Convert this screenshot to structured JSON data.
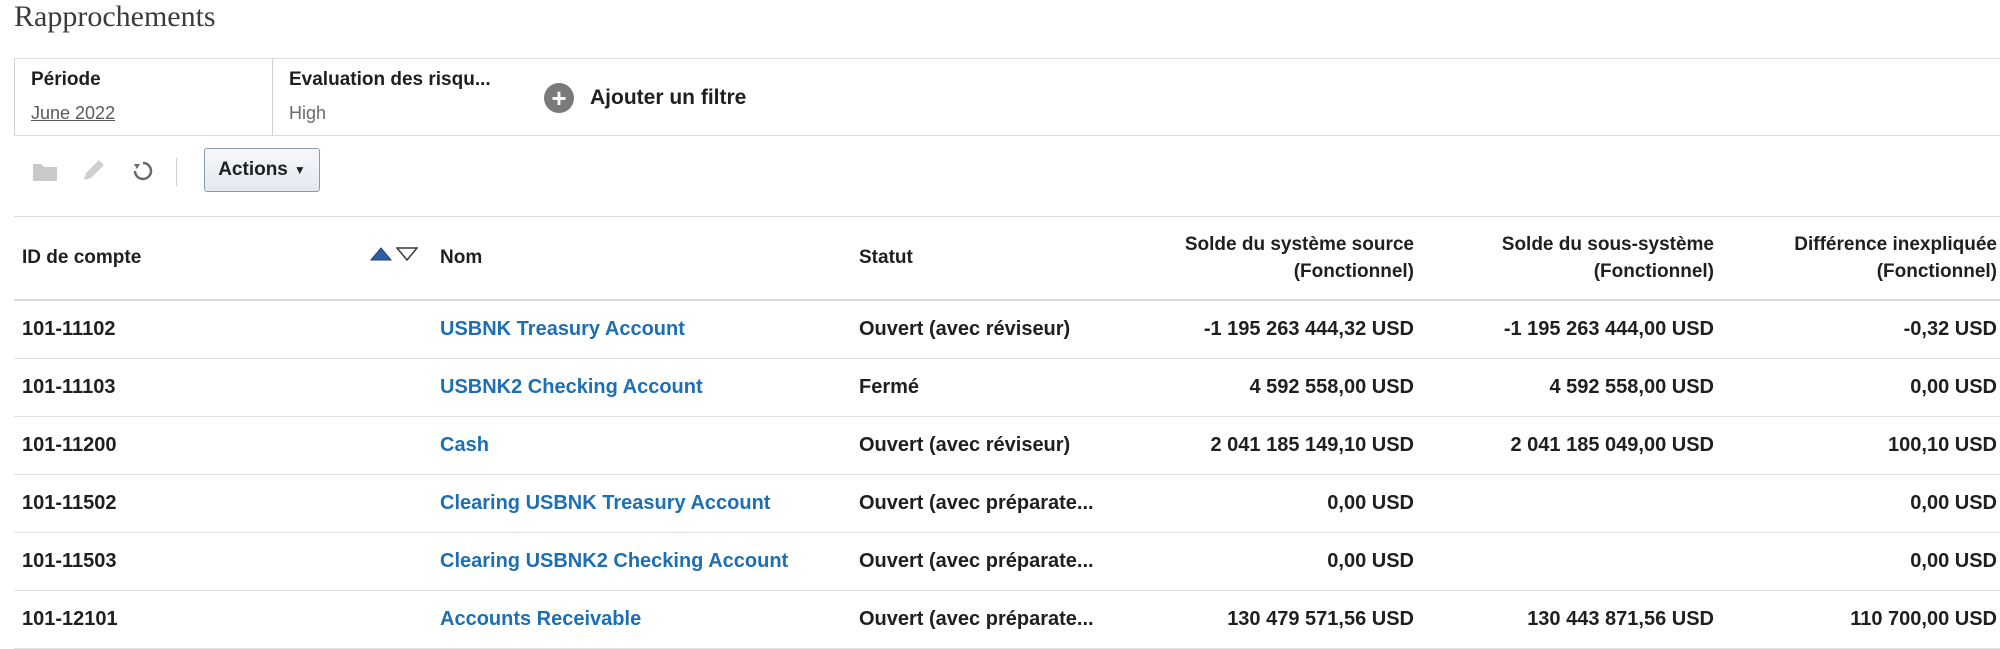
{
  "page": {
    "title": "Rapprochements"
  },
  "filters": [
    {
      "label": "Période",
      "value": "June 2022"
    },
    {
      "label": "Evaluation des risqu...",
      "value": "High"
    }
  ],
  "add_filter_label": "Ajouter un filtre",
  "toolbar": {
    "icons": [
      "folder-icon",
      "edit-pencil-icon",
      "refresh-icon"
    ],
    "actions_label": "Actions"
  },
  "table": {
    "headers": {
      "id": "ID de compte",
      "nom": "Nom",
      "statut": "Statut",
      "source_line1": "Solde du système source",
      "source_line2": "(Fonctionnel)",
      "sub_line1": "Solde du sous-système",
      "sub_line2": "(Fonctionnel)",
      "diff_line1": "Différence inexpliquée",
      "diff_line2": "(Fonctionnel)"
    },
    "rows": [
      {
        "id": "101-11102",
        "nom": "USBNK Treasury Account",
        "statut": "Ouvert (avec réviseur)",
        "source": "-1 195 263 444,32 USD",
        "sub": "-1 195 263 444,00 USD",
        "diff": "-0,32 USD"
      },
      {
        "id": "101-11103",
        "nom": "USBNK2 Checking Account",
        "statut": "Fermé",
        "source": "4 592 558,00 USD",
        "sub": "4 592 558,00 USD",
        "diff": "0,00 USD"
      },
      {
        "id": "101-11200",
        "nom": "Cash",
        "statut": "Ouvert (avec réviseur)",
        "source": "2 041 185 149,10 USD",
        "sub": "2 041 185 049,00 USD",
        "diff": "100,10 USD"
      },
      {
        "id": "101-11502",
        "nom": "Clearing USBNK Treasury Account",
        "statut": "Ouvert (avec préparate...",
        "source": "0,00 USD",
        "sub": "",
        "diff": "0,00 USD"
      },
      {
        "id": "101-11503",
        "nom": "Clearing USBNK2 Checking Account",
        "statut": "Ouvert (avec préparate...",
        "source": "0,00 USD",
        "sub": "",
        "diff": "0,00 USD"
      },
      {
        "id": "101-12101",
        "nom": "Accounts Receivable",
        "statut": "Ouvert (avec préparate...",
        "source": "130 479 571,56 USD",
        "sub": "130 443 871,56 USD",
        "diff": "110 700,00 USD"
      }
    ]
  },
  "colors": {
    "link": "#1d6fb3",
    "text": "#1f1f1f",
    "muted": "#6a6a6a"
  }
}
